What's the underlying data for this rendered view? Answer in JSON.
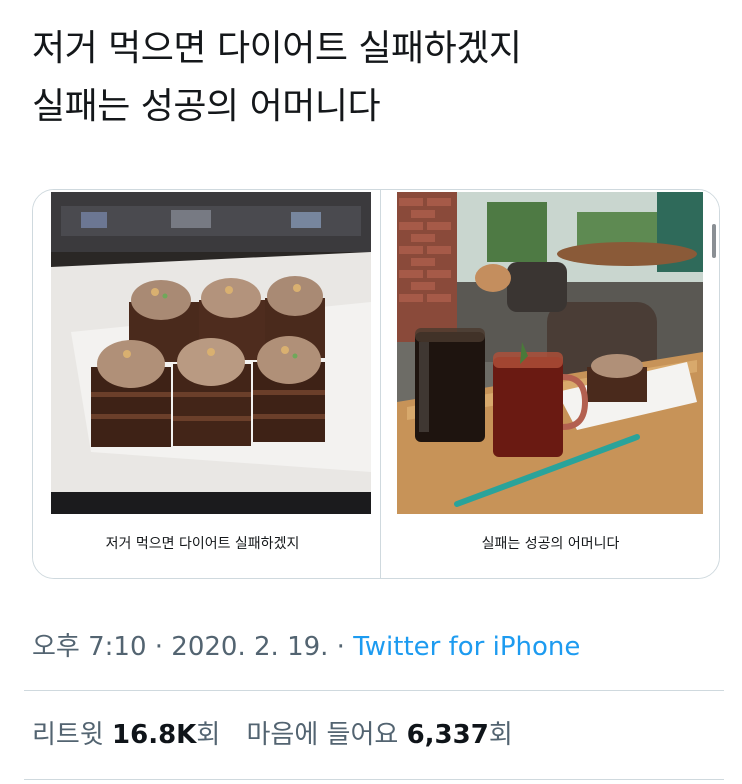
{
  "tweet": {
    "line1": "저거 먹으면 다이어트 실패하겠지",
    "line2": "실패는 성공의 어머니다"
  },
  "media": [
    {
      "caption": "저거 먹으면 다이어트 실패하겠지",
      "photo": "chocolate cakes in display case"
    },
    {
      "caption": "실패는 성공의 어머니다",
      "photo": "iced coffee, iced tea and cake on a wooden tray"
    }
  ],
  "meta": {
    "time": "오후 7:10",
    "sep1": " · ",
    "date": "2020. 2. 19.",
    "sep2": " · ",
    "source": "Twitter for iPhone"
  },
  "stats": {
    "retweets_label": "리트윗",
    "retweets_count": "16.8K",
    "retweets_suffix": "회",
    "likes_label": "마음에 들어요",
    "likes_count": "6,337",
    "likes_suffix": "회"
  },
  "colors": {
    "link": "#1d9bf0",
    "secondary": "#536471",
    "border": "#cfd9de"
  }
}
